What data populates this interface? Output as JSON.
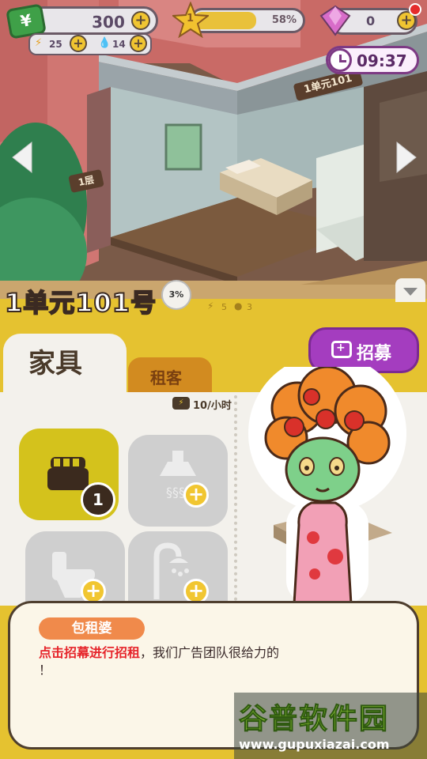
{
  "hud": {
    "money_icon": "yen-banknote-icon",
    "money": "300",
    "energy": "25",
    "water": "14",
    "level": "1",
    "progress_fraction": 0.58,
    "progress_text": "58%",
    "gems": "0",
    "timer": "09:37"
  },
  "room": {
    "sign_unit": "1单元101",
    "sign_floor": "1层",
    "title": "1单元101号",
    "occupancy": "3%",
    "energy_cost": "5",
    "water_cost": "3"
  },
  "tabs": {
    "furniture": "家具",
    "tenant": "租客"
  },
  "recruit_button": "招募",
  "income_rate": "10/小时",
  "furniture": [
    {
      "icon": "bed-icon",
      "count": "1",
      "active": true
    },
    {
      "icon": "range-hood-icon",
      "active": false
    },
    {
      "icon": "toilet-icon",
      "active": false
    },
    {
      "icon": "shower-icon",
      "active": false
    }
  ],
  "dialog": {
    "speaker": "包租婆",
    "highlight": "点击招幕进行招租",
    "rest": "，我们广告团队很给力的",
    "end": "！"
  },
  "watermark": {
    "title": "谷普软件园",
    "url": "www.gupuxiazai.com"
  },
  "colors": {
    "panel_yellow": "#e5c230",
    "recruit_purple": "#a43dbf",
    "dialog_red": "#e6242a",
    "speaker_orange": "#f08a4b"
  }
}
